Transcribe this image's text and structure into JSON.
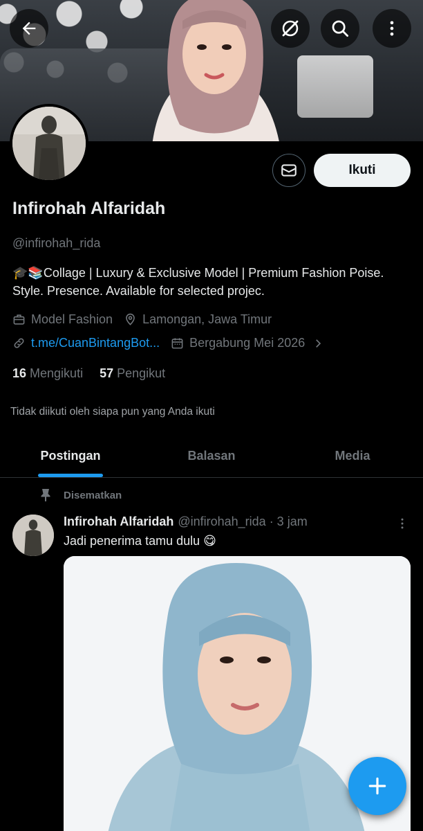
{
  "header": {
    "back_icon": "arrow-left-icon",
    "grok_icon": "no-entry-icon",
    "search_icon": "search-icon",
    "more_icon": "more-vertical-icon"
  },
  "profile": {
    "name": "Infirohah Alfaridah",
    "handle": "@infirohah_rida",
    "bio": "🎓📚Collage | Luxury & Exclusive Model | Premium Fashion Poise. Style. Presence. Available for selected projec.",
    "category": "Model Fashion",
    "location": "Lamongan, Jawa Timur",
    "link": "t.me/CuanBintangBot...",
    "joined": "Bergabung Mei 2026",
    "following_count": "16",
    "following_label": "Mengikuti",
    "followers_count": "57",
    "followers_label": "Pengikut",
    "not_followed_text": "Tidak diikuti oleh siapa pun yang Anda ikuti"
  },
  "actions": {
    "follow_label": "Ikuti",
    "message_icon": "mail-icon"
  },
  "tabs": [
    {
      "label": "Postingan",
      "active": true
    },
    {
      "label": "Balasan",
      "active": false
    },
    {
      "label": "Media",
      "active": false
    }
  ],
  "post": {
    "pinned_label": "Disematkan",
    "author_name": "Infirohah Alfaridah",
    "author_meta": "@infirohah_rida · 3 jam",
    "text": "Jadi penerima tamu dulu 😋"
  },
  "fab": {
    "icon": "plus-icon"
  },
  "colors": {
    "accent": "#1d9bf0",
    "background": "#000000",
    "secondary_text": "#71767b"
  }
}
